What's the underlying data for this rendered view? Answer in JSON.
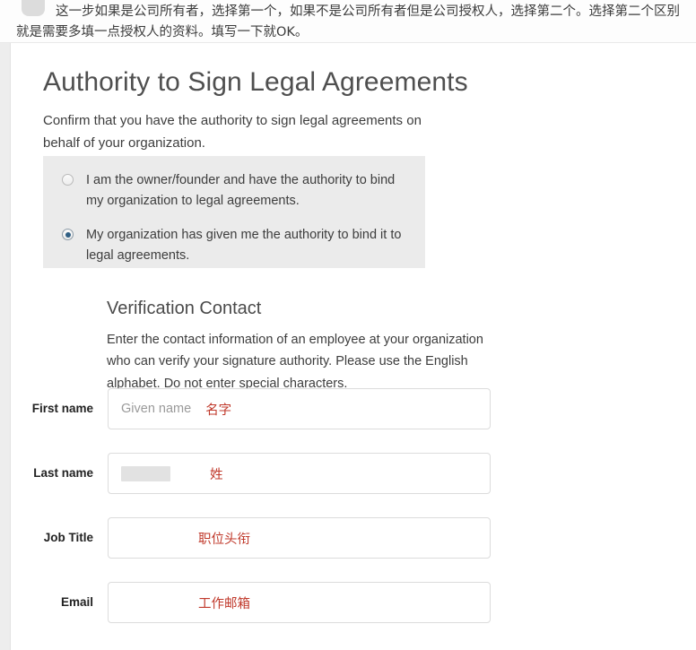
{
  "annotation": {
    "avatar_icon": "user-avatar-placeholder",
    "text": "这一步如果是公司所有者，选择第一个，如果不是公司所有者但是公司授权人，选择第二个。选择第二个区别就是需要多填一点授权人的资料。填写一下就OK。",
    "note_color": "#c0392b"
  },
  "page": {
    "title": "Authority to Sign Legal Agreements",
    "description": "Confirm that you have the authority to sign legal agreements on behalf of your organization."
  },
  "authority_options": {
    "selected_index": 1,
    "items": [
      {
        "label": "I am the owner/founder and have the authority to bind my organization to legal agreements.",
        "selected": false
      },
      {
        "label": "My organization has given me the authority to bind it to legal agreements.",
        "selected": true
      }
    ]
  },
  "verification_contact": {
    "title": "Verification Contact",
    "description": "Enter the contact information of an employee at your organization who can verify your signature authority. Please use the English alphabet. Do not enter special characters.",
    "fields": [
      {
        "label": "First name",
        "placeholder": "Given name",
        "value": "",
        "redacted": false,
        "note": "名字"
      },
      {
        "label": "Last name",
        "placeholder": "",
        "value": "",
        "redacted": true,
        "note": "姓"
      },
      {
        "label": "Job Title",
        "placeholder": "",
        "value": "",
        "redacted": false,
        "note": "职位头衔"
      },
      {
        "label": "Email",
        "placeholder": "",
        "value": "",
        "redacted": false,
        "note": "工作邮箱"
      }
    ]
  },
  "colors": {
    "panel_background": "#ebebeb",
    "radio_selected": "#2f5f84",
    "annotation_red": "#c0392b",
    "field_border": "#dcdcdc",
    "heading": "#4f4f4f"
  }
}
